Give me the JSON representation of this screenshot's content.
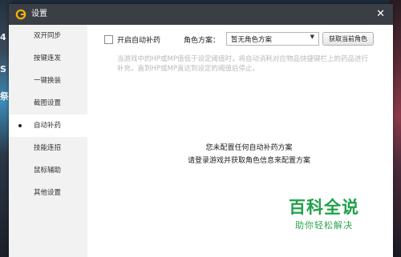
{
  "window": {
    "title": "设置"
  },
  "background": {
    "left_text": [
      "4",
      "S",
      "祭"
    ]
  },
  "sidebar": {
    "items": [
      {
        "label": "双开同步"
      },
      {
        "label": "按键连发"
      },
      {
        "label": "一键换装"
      },
      {
        "label": "截图设置"
      },
      {
        "label": "自动补药",
        "active": true
      },
      {
        "label": "技能连招"
      },
      {
        "label": "鼠标辅助"
      },
      {
        "label": "其他设置"
      }
    ]
  },
  "main": {
    "auto_potion_label": "开启自动补药",
    "auto_potion_checked": false,
    "role_label": "角色方案：",
    "role_select": {
      "value": "暂无角色方案"
    },
    "fetch_button": "获取当前角色",
    "description": "当游戏中的HP或MP值低于设定阈值时，将自动消耗对应物品快捷键栏上的药品进行补充，直到HP或MP直达到设定的阈值后停止。",
    "empty_line1": "您未配置任何自动补药方案",
    "empty_line2": "请登录游戏并获取角色信息来配置方案"
  },
  "watermark": {
    "title": "百科全说",
    "subtitle": "助你轻松解决"
  },
  "colors": {
    "titlebar": "#3a3f45",
    "sidebar": "#f2f2f2",
    "watermark": "#1ea14a",
    "logo": "#f5b301"
  }
}
